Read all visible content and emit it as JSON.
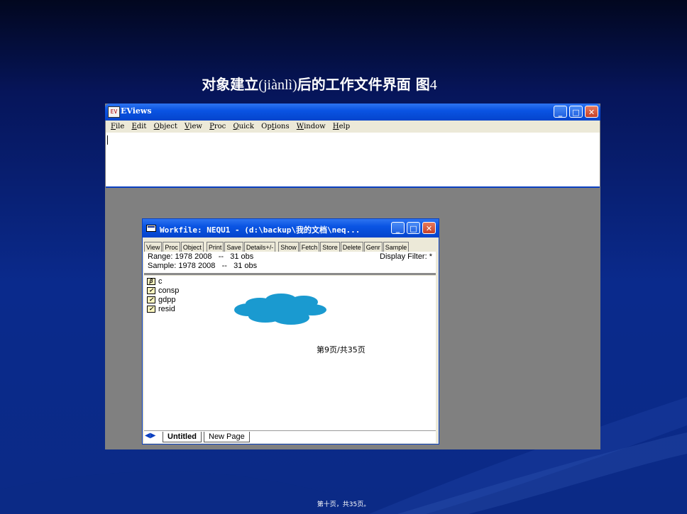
{
  "slide": {
    "title_prefix": "对象建立",
    "title_pinyin": "(jiànlì)",
    "title_suffix": "后的工作文件界面 图",
    "title_number": "4",
    "footer": "第十页，共35页。",
    "page_marker": "第9页/共35页"
  },
  "eviews": {
    "icon_text": "EV",
    "title": "EViews",
    "menu": [
      "File",
      "Edit",
      "Object",
      "View",
      "Proc",
      "Quick",
      "Options",
      "Window",
      "Help"
    ],
    "menu_underline": [
      "F",
      "E",
      "O",
      "V",
      "P",
      "Q",
      "t",
      "W",
      "H"
    ],
    "titlebar_buttons": [
      "minimize",
      "maximize",
      "close"
    ]
  },
  "workfile": {
    "title": "Workfile: NEQU1 - (d:\\backup\\我的文档\\neq...",
    "toolbar": [
      "View",
      "Proc",
      "Object",
      "Print",
      "Save",
      "Details+/-",
      "Show",
      "Fetch",
      "Store",
      "Delete",
      "Genr",
      "Sample"
    ],
    "range_label": "Range:",
    "range_value": "1978 2008   --   31 obs",
    "sample_label": "Sample:",
    "sample_value": "1978 2008   --   31 obs",
    "display_filter": "Display Filter: *",
    "objects": [
      {
        "name": "c",
        "icon": "coef-icon"
      },
      {
        "name": "consp",
        "icon": "series-icon"
      },
      {
        "name": "gdpp",
        "icon": "series-icon"
      },
      {
        "name": "resid",
        "icon": "series-icon"
      }
    ],
    "tabs": [
      "Untitled",
      "New Page"
    ]
  },
  "colors": {
    "xp_blue": "#0a54e3",
    "cloud": "#1a9ad0"
  }
}
